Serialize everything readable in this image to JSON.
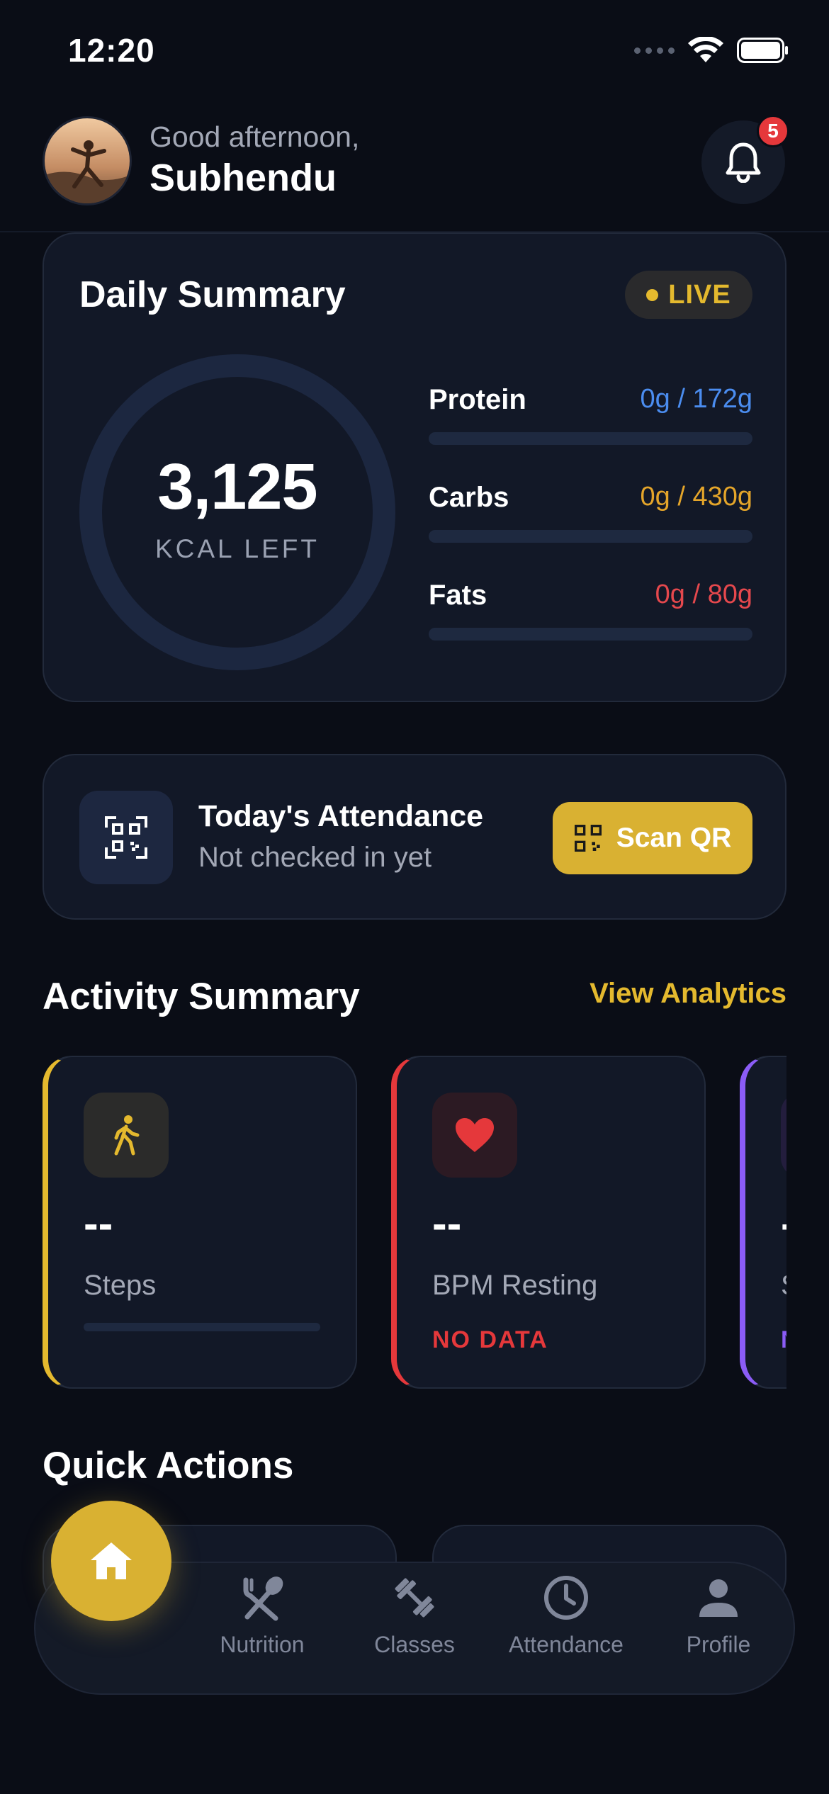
{
  "status_bar": {
    "time": "12:20"
  },
  "header": {
    "greeting": "Good afternoon,",
    "user_name": "Subhendu",
    "notification_count": "5"
  },
  "daily_summary": {
    "title": "Daily Summary",
    "live_label": "LIVE",
    "calories_value": "3,125",
    "calories_label": "KCAL LEFT",
    "macros": [
      {
        "name": "Protein",
        "value": "0g / 172g",
        "color": "#4b8df0",
        "progress": 0
      },
      {
        "name": "Carbs",
        "value": "0g / 430g",
        "color": "#e4a52a",
        "progress": 0
      },
      {
        "name": "Fats",
        "value": "0g / 80g",
        "color": "#e5484d",
        "progress": 0
      }
    ]
  },
  "attendance": {
    "title": "Today's Attendance",
    "subtitle": "Not checked in yet",
    "button_label": "Scan QR"
  },
  "activity": {
    "title": "Activity Summary",
    "link": "View Analytics",
    "cards": [
      {
        "value": "--",
        "label": "Steps",
        "accent": "#e4b92e",
        "progress": 0
      },
      {
        "value": "--",
        "label": "BPM Resting",
        "status": "NO DATA",
        "accent": "#e5383b"
      },
      {
        "value": "-",
        "label": "S",
        "status": "N",
        "accent": "#8b5cf6"
      }
    ]
  },
  "quick_actions": {
    "title": "Quick Actions"
  },
  "nav": {
    "items": [
      {
        "label": "Nutrition"
      },
      {
        "label": "Classes"
      },
      {
        "label": "Attendance"
      },
      {
        "label": "Profile"
      }
    ]
  },
  "colors": {
    "accent": "#d9b132",
    "background": "#0a0d16",
    "card": "#121827"
  }
}
